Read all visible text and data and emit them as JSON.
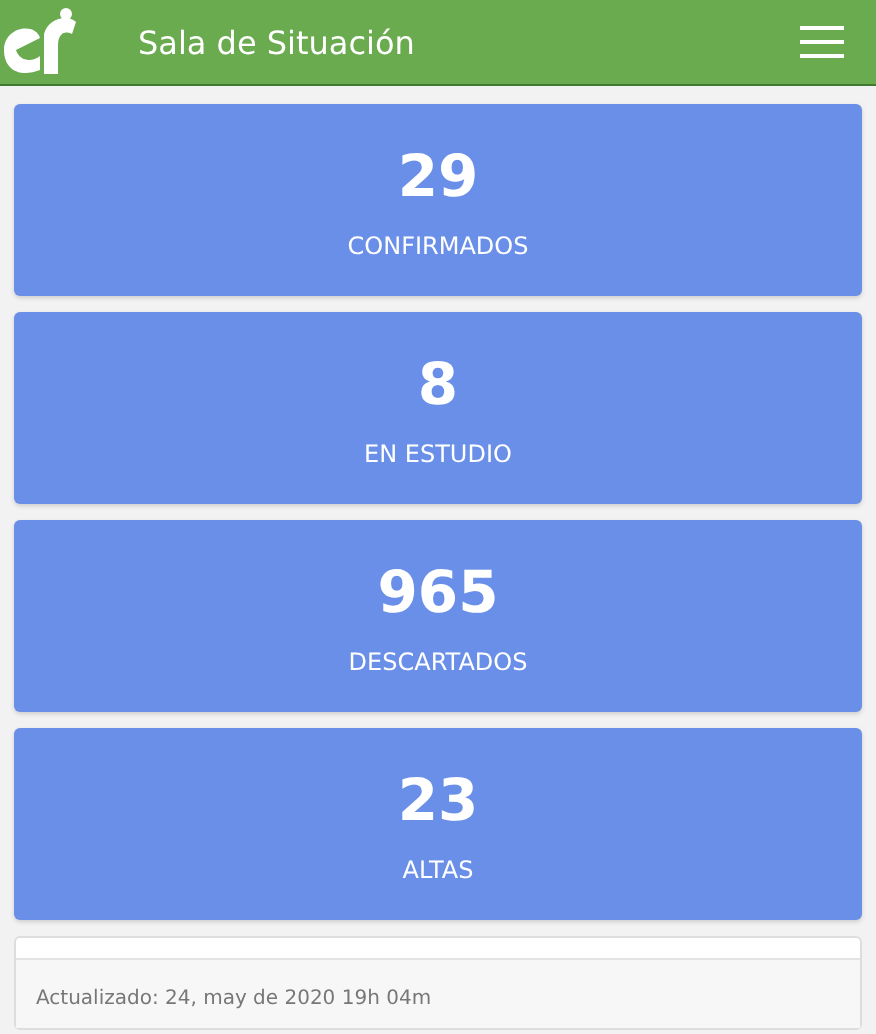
{
  "header": {
    "title": "Sala de Situación"
  },
  "stats": [
    {
      "value": "29",
      "label": "CONFIRMADOS"
    },
    {
      "value": "8",
      "label": "EN ESTUDIO"
    },
    {
      "value": "965",
      "label": "DESCARTADOS"
    },
    {
      "value": "23",
      "label": "ALTAS"
    }
  ],
  "footer": {
    "updated": "Actualizado: 24, may de 2020 19h 04m"
  }
}
